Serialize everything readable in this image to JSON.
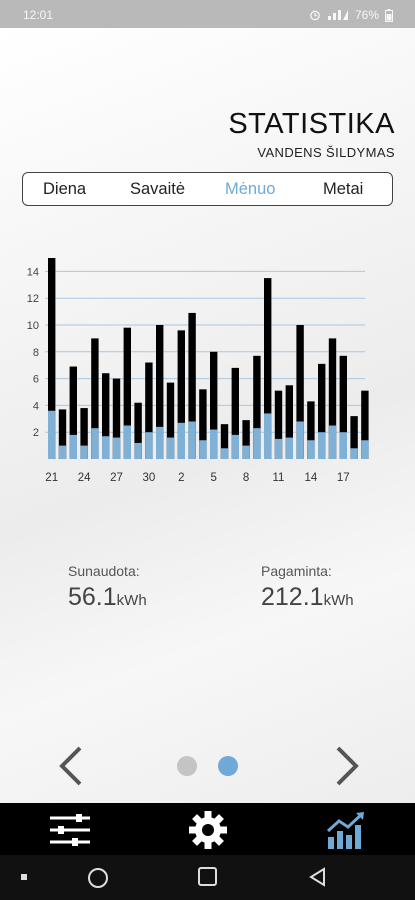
{
  "statusbar": {
    "time": "12:01",
    "battery": "76%"
  },
  "header": {
    "title": "STATISTIKA",
    "subtitle": "VANDENS ŠILDYMAS"
  },
  "tabs": [
    {
      "label": "Diena",
      "active": false
    },
    {
      "label": "Savaitė",
      "active": false
    },
    {
      "label": "Mėnuo",
      "active": true
    },
    {
      "label": "Metai",
      "active": false
    }
  ],
  "chart_data": {
    "type": "bar",
    "stacked": true,
    "yticks": [
      "2",
      "4",
      "6",
      "8",
      "10",
      "12",
      "14"
    ],
    "ylim": [
      0,
      15
    ],
    "xtick_labels": [
      "21",
      "24",
      "27",
      "30",
      "2",
      "5",
      "8",
      "11",
      "14",
      "17"
    ],
    "categories": [
      "21",
      "22",
      "23",
      "24",
      "25",
      "26",
      "27",
      "28",
      "29",
      "30",
      "1",
      "2",
      "3",
      "4",
      "5",
      "6",
      "7",
      "8",
      "9",
      "10",
      "11",
      "12",
      "13",
      "14",
      "15",
      "16",
      "17",
      "18",
      "19"
    ],
    "series": [
      {
        "color": "#7fb0d6",
        "values": [
          3.6,
          1.0,
          1.8,
          1.0,
          2.3,
          1.7,
          1.6,
          2.5,
          1.2,
          2.0,
          2.4,
          1.6,
          2.7,
          2.8,
          1.4,
          2.2,
          0.8,
          1.8,
          1.0,
          2.3,
          3.4,
          1.5,
          1.6,
          2.8,
          1.4,
          2.0,
          2.5,
          2.0,
          0.8,
          1.4
        ]
      },
      {
        "color": "#000000",
        "values": [
          15.0,
          3.7,
          6.9,
          3.8,
          9.0,
          6.4,
          6.0,
          9.8,
          4.2,
          7.2,
          10.0,
          5.7,
          9.6,
          10.9,
          5.2,
          8.0,
          2.6,
          6.8,
          2.9,
          7.7,
          13.5,
          5.1,
          5.5,
          10.0,
          4.3,
          7.1,
          9.0,
          7.7,
          3.2,
          5.1
        ]
      }
    ],
    "grid": true,
    "gridline_color": "#a9c7e0"
  },
  "stats": {
    "used_label": "Sunaudota:",
    "used_value": "56.1",
    "used_unit": "kWh",
    "produced_label": "Pagaminta:",
    "produced_value": "212.1",
    "produced_unit": "kWh"
  },
  "pager": {
    "dot_inactive_color": "#c4c4c4",
    "dot_active_color": "#6fa9d6"
  },
  "bottom_nav": [
    {
      "icon": "sliders-icon"
    },
    {
      "icon": "gear-icon"
    },
    {
      "icon": "statistics-chart-icon",
      "active": true
    }
  ],
  "system_nav": [
    {
      "icon": "recent-dot-icon"
    },
    {
      "icon": "home-circle-icon"
    },
    {
      "icon": "overview-square-icon"
    },
    {
      "icon": "back-triangle-icon"
    }
  ]
}
